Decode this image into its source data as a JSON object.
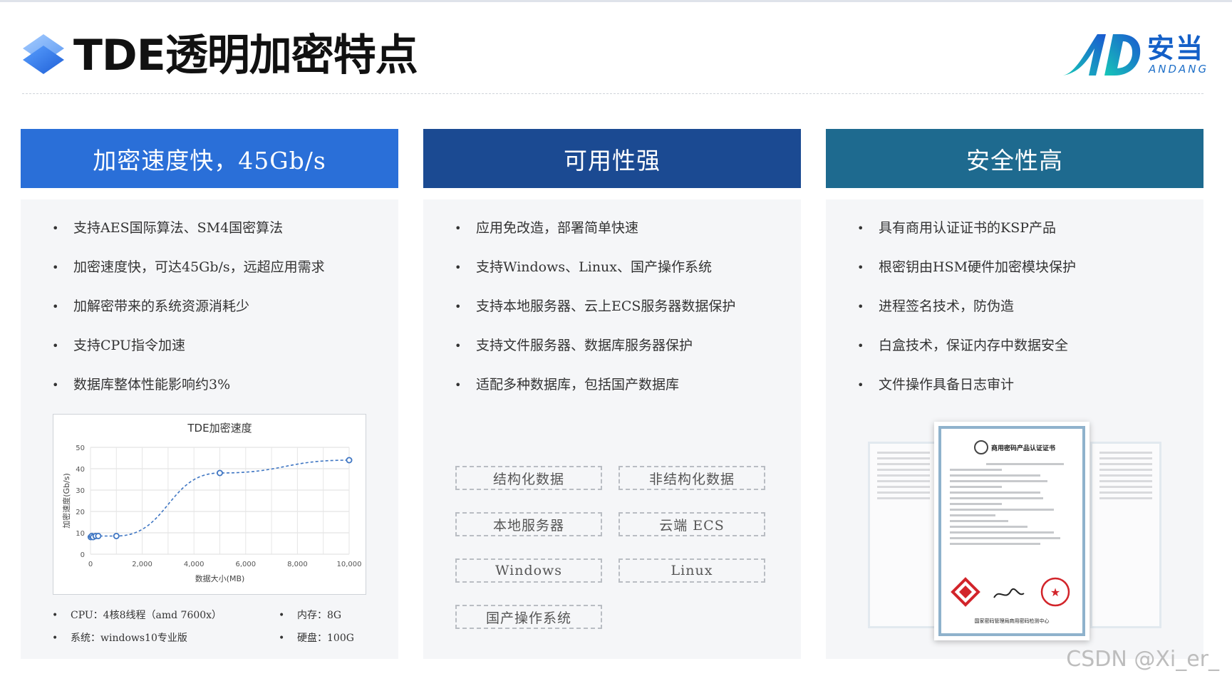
{
  "header": {
    "title": "TDE透明加密特点",
    "brand_cn": "安当",
    "brand_en": "ANDANG"
  },
  "colors": {
    "col1": "#2a6fd8",
    "col2": "#1b4a92",
    "col3": "#1e6a8f",
    "panel": "#f5f6f8",
    "chart_line": "#3f76c3"
  },
  "columns": [
    {
      "heading": "加密速度快，45Gb/s",
      "bullets": [
        "支持AES国际算法、SM4国密算法",
        "加密速度快，可达45Gb/s，远超应用需求",
        "加解密带来的系统资源消耗少",
        "支持CPU指令加速",
        "数据库整体性能影响约3%"
      ],
      "specs": {
        "cpu": "CPU：4核8线程（amd 7600x）",
        "memory": "内存：8G",
        "os": "系统：windows10专业版",
        "disk": "硬盘：100G"
      }
    },
    {
      "heading": "可用性强",
      "bullets": [
        "应用免改造，部署简单快速",
        "支持Windows、Linux、国产操作系统",
        "支持本地服务器、云上ECS服务器数据保护",
        "支持文件服务器、数据库服务器保护",
        "适配多种数据库，包括国产数据库"
      ],
      "tags": [
        "结构化数据",
        "非结构化数据",
        "本地服务器",
        "云端 ECS",
        "Windows",
        "Linux",
        "国产操作系统"
      ]
    },
    {
      "heading": "安全性高",
      "bullets": [
        "具有商用认证证书的KSP产品",
        "根密钥由HSM硬件加密模块保护",
        "进程签名技术，防伪造",
        "白盒技术，保证内存中数据安全",
        "文件操作具备日志审计"
      ],
      "certificate": {
        "title": "商用密码产品认证证书",
        "footer": "国家密码管理局商用密码检测中心"
      }
    }
  ],
  "chart_data": {
    "type": "line",
    "title": "TDE加密速度",
    "xlabel": "数据大小(MB)",
    "ylabel": "加密速度(Gb/s)",
    "x": [
      10,
      50,
      100,
      200,
      300,
      1000,
      5000,
      10000
    ],
    "series": [
      {
        "values": [
          8,
          8.5,
          8,
          8.5,
          8.5,
          8.5,
          38,
          44
        ]
      }
    ],
    "xlim": [
      0,
      10000
    ],
    "ylim": [
      0,
      50
    ],
    "xticks": [
      0,
      2000,
      4000,
      6000,
      8000,
      10000
    ],
    "xtick_labels": [
      "0",
      "2,000",
      "4,000",
      "6,000",
      "8,000",
      "10,000"
    ],
    "yticks": [
      0,
      10,
      20,
      30,
      40,
      50
    ],
    "grid": true
  },
  "watermark": "CSDN @Xi_er_"
}
